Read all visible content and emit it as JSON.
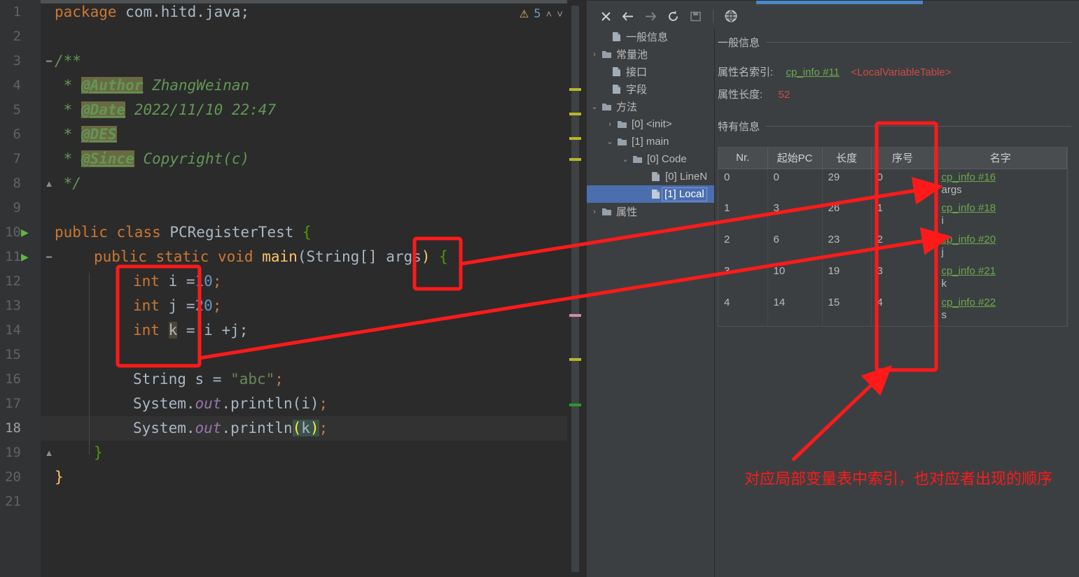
{
  "editor": {
    "warning_icon": "warning-triangle-icon",
    "warning_count": "5",
    "chevron_up": "˄",
    "chevron_down": "˅",
    "lines": [
      {
        "n": "1",
        "run": false
      },
      {
        "n": "2",
        "run": false
      },
      {
        "n": "3",
        "run": false
      },
      {
        "n": "4",
        "run": false
      },
      {
        "n": "5",
        "run": false
      },
      {
        "n": "6",
        "run": false
      },
      {
        "n": "7",
        "run": false
      },
      {
        "n": "8",
        "run": false
      },
      {
        "n": "9",
        "run": false
      },
      {
        "n": "10",
        "run": true
      },
      {
        "n": "11",
        "run": true
      },
      {
        "n": "12",
        "run": false
      },
      {
        "n": "13",
        "run": false
      },
      {
        "n": "14",
        "run": false
      },
      {
        "n": "15",
        "run": false
      },
      {
        "n": "16",
        "run": false
      },
      {
        "n": "17",
        "run": false
      },
      {
        "n": "18",
        "run": false
      },
      {
        "n": "19",
        "run": false
      },
      {
        "n": "20",
        "run": false
      },
      {
        "n": "21",
        "run": false
      }
    ],
    "source": {
      "l1_package": "package",
      "l1_name": " com.hitd.java;",
      "l3": "/**",
      "l4_star": " * ",
      "l4_tag": "@Author",
      "l4_rest": " ZhangWeinan",
      "l5_star": " * ",
      "l5_tag": "@Date",
      "l5_rest": " 2022/11/10 22:47",
      "l6_star": " * ",
      "l6_tag": "@DES",
      "l7_star": " * ",
      "l7_tag": "@Since",
      "l7_rest": " Copyright(c)",
      "l8": " */",
      "l10_pub": "public",
      "l10_cls": "class",
      "l10_name": " PCRegisterTest ",
      "l10_brace": "{",
      "l11_mods": "public static void",
      "l11_main": "main",
      "l11_p1": "(",
      "l11_type": "String[] ",
      "l11_arg": "args",
      "l11_p2": ")",
      "l11_brace": " {",
      "l12_kw": "int",
      "l12_rest": " i =",
      "l12_num": "10",
      "l12_semi": ";",
      "l13_kw": "int",
      "l13_rest": " j =",
      "l13_num": "20",
      "l13_semi": ";",
      "l14_kw": "int",
      "l14_var": "k",
      "l14_rest": " = i +j;",
      "l16_type": "String",
      "l16_mid": " s = ",
      "l16_str": "\"abc\"",
      "l16_semi": ";",
      "l17_sys": "System.",
      "l17_out": "out",
      "l17_pr": ".println(i)",
      "l17_semi": ";",
      "l18_sys": "System.",
      "l18_out": "out",
      "l18_pr": ".println",
      "l18_p1": "(",
      "l18_k": "k",
      "l18_p2": ")",
      "l18_semi": ";",
      "l19_brace": "}",
      "l20_brace": "}"
    }
  },
  "toolbar": {
    "close": "close-icon",
    "back": "back-arrow-icon",
    "forward": "forward-arrow-icon",
    "refresh": "refresh-icon",
    "save": "save-icon",
    "browser": "globe-icon"
  },
  "tree": {
    "items": [
      {
        "label": "一般信息",
        "indent": 1,
        "twisty": "",
        "icon": "file-icon",
        "selected": false
      },
      {
        "label": "常量池",
        "indent": 0,
        "twisty": "›",
        "icon": "folder-icon",
        "selected": false
      },
      {
        "label": "接口",
        "indent": 1,
        "twisty": "",
        "icon": "file-icon",
        "selected": false
      },
      {
        "label": "字段",
        "indent": 1,
        "twisty": "",
        "icon": "file-icon",
        "selected": false
      },
      {
        "label": "方法",
        "indent": 0,
        "twisty": "⌄",
        "icon": "folder-icon",
        "selected": false
      },
      {
        "label": "[0] <init>",
        "indent": 1,
        "twisty": "›",
        "icon": "folder-icon",
        "selected": false
      },
      {
        "label": "[1] main",
        "indent": 1,
        "twisty": "⌄",
        "icon": "folder-icon",
        "selected": false
      },
      {
        "label": "[0] Code",
        "indent": 2,
        "twisty": "⌄",
        "icon": "folder-icon",
        "selected": false
      },
      {
        "label": "[0] LineN",
        "indent": 4,
        "twisty": "",
        "icon": "file-icon",
        "selected": false
      },
      {
        "label": "[1] Local",
        "indent": 4,
        "twisty": "",
        "icon": "file-icon",
        "selected": true
      },
      {
        "label": "属性",
        "indent": 0,
        "twisty": "›",
        "icon": "folder-icon",
        "selected": false
      }
    ]
  },
  "detail": {
    "general_section": "一般信息",
    "attr_name_index_label": "属性名索引:",
    "attr_name_index_value": "cp_info #11",
    "attr_name_index_extra": "<LocalVariableTable>",
    "attr_length_label": "属性长度:",
    "attr_length_value": "52",
    "specific_section": "特有信息",
    "table": {
      "columns": [
        "Nr.",
        "起始PC",
        "长度",
        "序号",
        "名字"
      ],
      "rows": [
        {
          "nr": "0",
          "start_pc": "0",
          "length": "29",
          "index": "0",
          "cp": "cp_info #16",
          "name": "args"
        },
        {
          "nr": "1",
          "start_pc": "3",
          "length": "26",
          "index": "1",
          "cp": "cp_info #18",
          "name": "i"
        },
        {
          "nr": "2",
          "start_pc": "6",
          "length": "23",
          "index": "2",
          "cp": "cp_info #20",
          "name": "j"
        },
        {
          "nr": "3",
          "start_pc": "10",
          "length": "19",
          "index": "3",
          "cp": "cp_info #21",
          "name": "k"
        },
        {
          "nr": "4",
          "start_pc": "14",
          "length": "15",
          "index": "4",
          "cp": "cp_info #22",
          "name": "s"
        }
      ]
    }
  },
  "annotation": {
    "note": "对应局部变量表中索引，也对应者出现的顺序",
    "color": "#ff1a1a"
  }
}
